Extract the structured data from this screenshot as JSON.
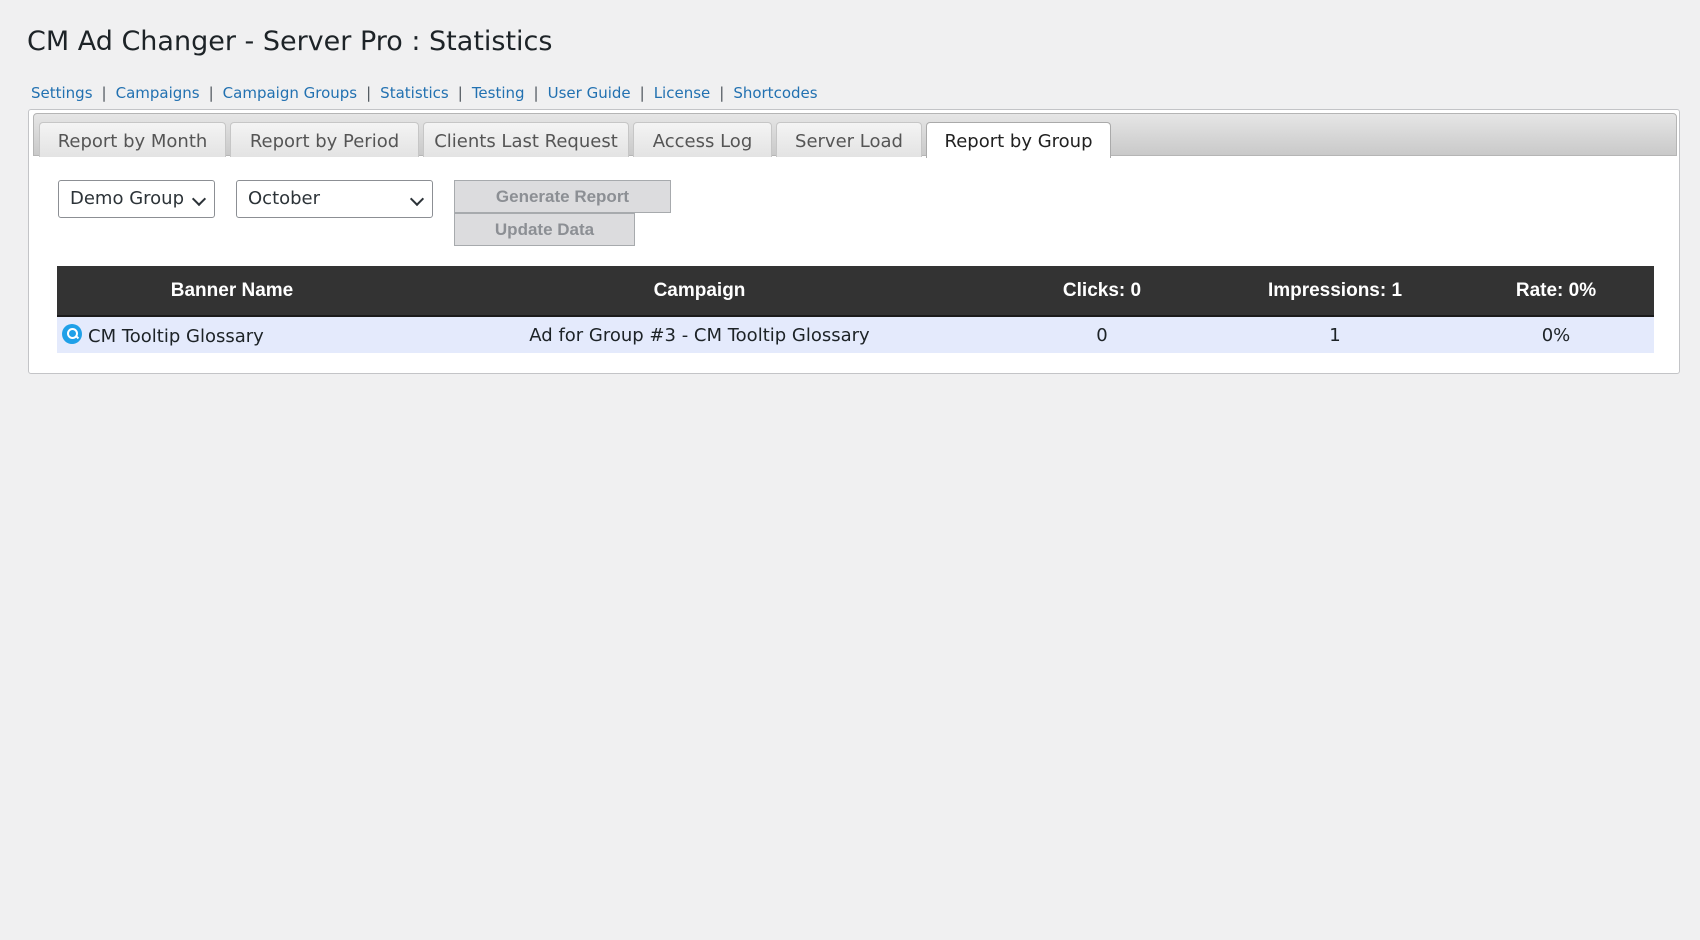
{
  "header": {
    "title": "CM Ad Changer - Server Pro : Statistics"
  },
  "nav_links": [
    "Settings",
    "Campaigns",
    "Campaign Groups",
    "Statistics",
    "Testing",
    "User Guide",
    "License",
    "Shortcodes"
  ],
  "nav_separator": "|",
  "tabs": [
    {
      "label": "Report by Month",
      "active": false
    },
    {
      "label": "Report by Period",
      "active": false
    },
    {
      "label": "Clients Last Request",
      "active": false
    },
    {
      "label": "Access Log",
      "active": false
    },
    {
      "label": "Server Load",
      "active": false
    },
    {
      "label": "Report by Group",
      "active": true
    }
  ],
  "filters": {
    "group_select": {
      "value": "Demo Group"
    },
    "month_select": {
      "value": "October"
    }
  },
  "buttons": {
    "generate_report": "Generate Report",
    "update_data": "Update Data"
  },
  "table": {
    "headers": [
      "Banner Name",
      "Campaign",
      "Clicks: 0",
      "Impressions: 1",
      "Rate: 0%"
    ],
    "rows": [
      {
        "banner_name": "CM Tooltip Glossary",
        "banner_icon": "magnifier-circle-icon",
        "campaign": "Ad for Group #3 - CM Tooltip Glossary",
        "clicks": "0",
        "impressions": "1",
        "rate": "0%"
      }
    ]
  },
  "colors": {
    "link": "#2271b1",
    "table_header_bg": "#333333",
    "row_bg": "#e4eafc",
    "page_bg": "#f0f0f1"
  }
}
